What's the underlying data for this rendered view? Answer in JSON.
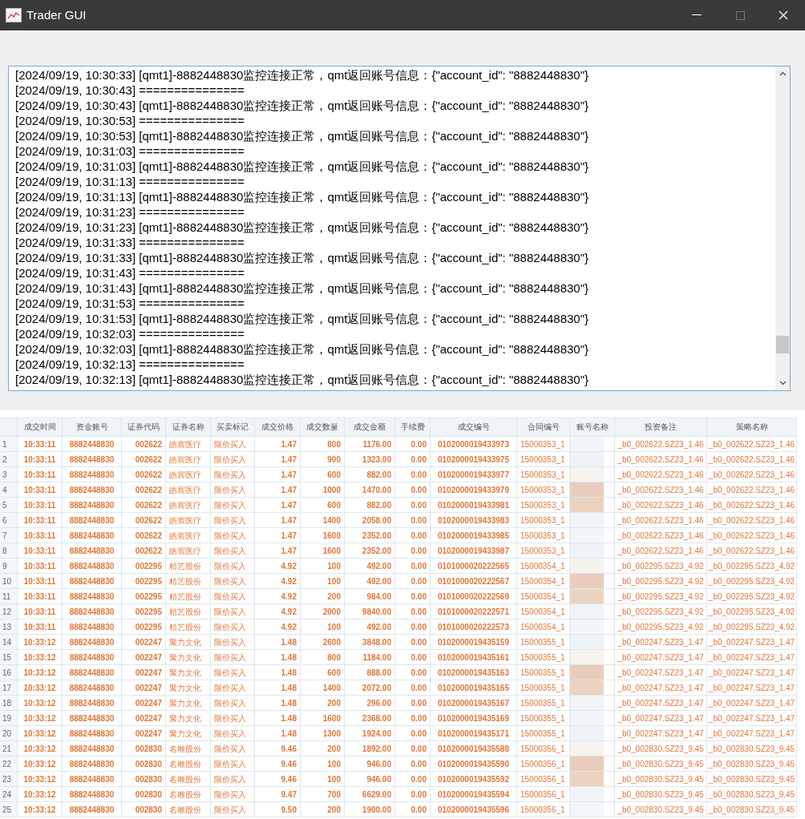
{
  "window": {
    "title": "Trader GUI"
  },
  "log": {
    "lines": [
      "[2024/09/19, 10:30:33] [qmt1]-8882448830监控连接正常，qmt返回账号信息：{\"account_id\": \"8882448830\"}",
      "[2024/09/19, 10:30:43] ===============",
      "[2024/09/19, 10:30:43] [qmt1]-8882448830监控连接正常，qmt返回账号信息：{\"account_id\": \"8882448830\"}",
      "[2024/09/19, 10:30:53] ===============",
      "[2024/09/19, 10:30:53] [qmt1]-8882448830监控连接正常，qmt返回账号信息：{\"account_id\": \"8882448830\"}",
      "[2024/09/19, 10:31:03] ===============",
      "[2024/09/19, 10:31:03] [qmt1]-8882448830监控连接正常，qmt返回账号信息：{\"account_id\": \"8882448830\"}",
      "[2024/09/19, 10:31:13] ===============",
      "[2024/09/19, 10:31:13] [qmt1]-8882448830监控连接正常，qmt返回账号信息：{\"account_id\": \"8882448830\"}",
      "[2024/09/19, 10:31:23] ===============",
      "[2024/09/19, 10:31:23] [qmt1]-8882448830监控连接正常，qmt返回账号信息：{\"account_id\": \"8882448830\"}",
      "[2024/09/19, 10:31:33] ===============",
      "[2024/09/19, 10:31:33] [qmt1]-8882448830监控连接正常，qmt返回账号信息：{\"account_id\": \"8882448830\"}",
      "[2024/09/19, 10:31:43] ===============",
      "[2024/09/19, 10:31:43] [qmt1]-8882448830监控连接正常，qmt返回账号信息：{\"account_id\": \"8882448830\"}",
      "[2024/09/19, 10:31:53] ===============",
      "[2024/09/19, 10:31:53] [qmt1]-8882448830监控连接正常，qmt返回账号信息：{\"account_id\": \"8882448830\"}",
      "[2024/09/19, 10:32:03] ===============",
      "[2024/09/19, 10:32:03] [qmt1]-8882448830监控连接正常，qmt返回账号信息：{\"account_id\": \"8882448830\"}",
      "[2024/09/19, 10:32:13] ===============",
      "[2024/09/19, 10:32:13] [qmt1]-8882448830监控连接正常，qmt返回账号信息：{\"account_id\": \"8882448830\"}"
    ]
  },
  "table": {
    "columns": [
      "成交时间",
      "资金账号",
      "证券代码",
      "证券名称",
      "买卖标记",
      "成交价格",
      "成交数量",
      "成交金额",
      "手续费",
      "成交编号",
      "合同编号",
      "账号名称",
      "投资备注",
      "策略名称"
    ],
    "rows": [
      {
        "n": "1",
        "cells": [
          "10:33:11",
          "8882448830",
          "002622",
          "皓宸医疗",
          "限价买入",
          "1.47",
          "800",
          "1176.00",
          "0.00",
          "0102000019433973",
          "15000353_1",
          "",
          "_b0_002622.SZ23_1.46",
          "_b0_002622.SZ23_1.46"
        ]
      },
      {
        "n": "2",
        "cells": [
          "10:33:11",
          "8882448830",
          "002622",
          "皓宸医疗",
          "限价买入",
          "1.47",
          "900",
          "1323.00",
          "0.00",
          "0102000019433975",
          "15000353_1",
          "",
          "_b0_002622.SZ23_1.46",
          "_b0_002622.SZ23_1.46"
        ]
      },
      {
        "n": "3",
        "cells": [
          "10:33:11",
          "8882448830",
          "002622",
          "皓宸医疗",
          "限价买入",
          "1.47",
          "600",
          "882.00",
          "0.00",
          "0102000019433977",
          "15000353_1",
          "",
          "_b0_002622.SZ23_1.46",
          "_b0_002622.SZ23_1.46"
        ]
      },
      {
        "n": "4",
        "cells": [
          "10:33:11",
          "8882448830",
          "002622",
          "皓宸医疗",
          "限价买入",
          "1.47",
          "1000",
          "1470.00",
          "0.00",
          "0102000019433979",
          "15000353_1",
          "",
          "_b0_002622.SZ23_1.46",
          "_b0_002622.SZ23_1.46"
        ]
      },
      {
        "n": "5",
        "cells": [
          "10:33:11",
          "8882448830",
          "002622",
          "皓宸医疗",
          "限价买入",
          "1.47",
          "600",
          "882.00",
          "0.00",
          "0102000019433981",
          "15000353_1",
          "",
          "_b0_002622.SZ23_1.46",
          "_b0_002622.SZ23_1.46"
        ]
      },
      {
        "n": "6",
        "cells": [
          "10:33:11",
          "8882448830",
          "002622",
          "皓宸医疗",
          "限价买入",
          "1.47",
          "1400",
          "2058.00",
          "0.00",
          "0102000019433983",
          "15000353_1",
          "",
          "_b0_002622.SZ23_1.46",
          "_b0_002622.SZ23_1.46"
        ]
      },
      {
        "n": "7",
        "cells": [
          "10:33:11",
          "8882448830",
          "002622",
          "皓宸医疗",
          "限价买入",
          "1.47",
          "1600",
          "2352.00",
          "0.00",
          "0102000019433985",
          "15000353_1",
          "",
          "_b0_002622.SZ23_1.46",
          "_b0_002622.SZ23_1.46"
        ]
      },
      {
        "n": "8",
        "cells": [
          "10:33:11",
          "8882448830",
          "002622",
          "皓宸医疗",
          "限价买入",
          "1.47",
          "1600",
          "2352.00",
          "0.00",
          "0102000019433987",
          "15000353_1",
          "",
          "_b0_002622.SZ23_1.46",
          "_b0_002622.SZ23_1.46"
        ]
      },
      {
        "n": "9",
        "cells": [
          "10:33:11",
          "8882448830",
          "002295",
          "精艺股份",
          "限价买入",
          "4.92",
          "100",
          "492.00",
          "0.00",
          "0101000020222565",
          "15000354_1",
          "",
          "_b0_002295.SZ23_4.92",
          "_b0_002295.SZ23_4.92"
        ]
      },
      {
        "n": "10",
        "cells": [
          "10:33:11",
          "8882448830",
          "002295",
          "精艺股份",
          "限价买入",
          "4.92",
          "100",
          "492.00",
          "0.00",
          "0101000020222567",
          "15000354_1",
          "",
          "_b0_002295.SZ23_4.92",
          "_b0_002295.SZ23_4.92"
        ]
      },
      {
        "n": "11",
        "cells": [
          "10:33:11",
          "8882448830",
          "002295",
          "精艺股份",
          "限价买入",
          "4.92",
          "200",
          "984.00",
          "0.00",
          "0101000020222569",
          "15000354_1",
          "",
          "_b0_002295.SZ23_4.92",
          "_b0_002295.SZ23_4.92"
        ]
      },
      {
        "n": "12",
        "cells": [
          "10:33:11",
          "8882448830",
          "002295",
          "精艺股份",
          "限价买入",
          "4.92",
          "2000",
          "9840.00",
          "0.00",
          "0101000020222571",
          "15000354_1",
          "",
          "_b0_002295.SZ23_4.92",
          "_b0_002295.SZ23_4.92"
        ]
      },
      {
        "n": "13",
        "cells": [
          "10:33:11",
          "8882448830",
          "002295",
          "精艺股份",
          "限价买入",
          "4.92",
          "100",
          "492.00",
          "0.00",
          "0101000020222573",
          "15000354_1",
          "",
          "_b0_002295.SZ23_4.92",
          "_b0_002295.SZ23_4.92"
        ]
      },
      {
        "n": "14",
        "cells": [
          "10:33:12",
          "8882448830",
          "002247",
          "聚力文化",
          "限价买入",
          "1.48",
          "2600",
          "3848.00",
          "0.00",
          "0102000019435159",
          "15000355_1",
          "",
          "_b0_002247.SZ23_1.47",
          "_b0_002247.SZ23_1.47"
        ]
      },
      {
        "n": "15",
        "cells": [
          "10:33:12",
          "8882448830",
          "002247",
          "聚力文化",
          "限价买入",
          "1.48",
          "800",
          "1184.00",
          "0.00",
          "0102000019435161",
          "15000355_1",
          "",
          "_b0_002247.SZ23_1.47",
          "_b0_002247.SZ23_1.47"
        ]
      },
      {
        "n": "16",
        "cells": [
          "10:33:12",
          "8882448830",
          "002247",
          "聚力文化",
          "限价买入",
          "1.48",
          "600",
          "888.00",
          "0.00",
          "0102000019435163",
          "15000355_1",
          "",
          "_b0_002247.SZ23_1.47",
          "_b0_002247.SZ23_1.47"
        ]
      },
      {
        "n": "17",
        "cells": [
          "10:33:12",
          "8882448830",
          "002247",
          "聚力文化",
          "限价买入",
          "1.48",
          "1400",
          "2072.00",
          "0.00",
          "0102000019435165",
          "15000355_1",
          "",
          "_b0_002247.SZ23_1.47",
          "_b0_002247.SZ23_1.47"
        ]
      },
      {
        "n": "18",
        "cells": [
          "10:33:12",
          "8882448830",
          "002247",
          "聚力文化",
          "限价买入",
          "1.48",
          "200",
          "296.00",
          "0.00",
          "0102000019435167",
          "15000355_1",
          "",
          "_b0_002247.SZ23_1.47",
          "_b0_002247.SZ23_1.47"
        ]
      },
      {
        "n": "19",
        "cells": [
          "10:33:12",
          "8882448830",
          "002247",
          "聚力文化",
          "限价买入",
          "1.48",
          "1600",
          "2368.00",
          "0.00",
          "0102000019435169",
          "15000355_1",
          "",
          "_b0_002247.SZ23_1.47",
          "_b0_002247.SZ23_1.47"
        ]
      },
      {
        "n": "20",
        "cells": [
          "10:33:12",
          "8882448830",
          "002247",
          "聚力文化",
          "限价买入",
          "1.48",
          "1300",
          "1924.00",
          "0.00",
          "0102000019435171",
          "15000355_1",
          "",
          "_b0_002247.SZ23_1.47",
          "_b0_002247.SZ23_1.47"
        ]
      },
      {
        "n": "21",
        "cells": [
          "10:33:12",
          "8882448830",
          "002830",
          "名雕股份",
          "限价买入",
          "9.46",
          "200",
          "1892.00",
          "0.00",
          "0102000019435588",
          "15000356_1",
          "",
          "_b0_002830.SZ23_9.45",
          "_b0_002830.SZ23_9.45"
        ]
      },
      {
        "n": "22",
        "cells": [
          "10:33:12",
          "8882448830",
          "002830",
          "名雕股份",
          "限价买入",
          "9.46",
          "100",
          "946.00",
          "0.00",
          "0102000019435590",
          "15000356_1",
          "",
          "_b0_002830.SZ23_9.45",
          "_b0_002830.SZ23_9.45"
        ]
      },
      {
        "n": "23",
        "cells": [
          "10:33:12",
          "8882448830",
          "002830",
          "名雕股份",
          "限价买入",
          "9.46",
          "100",
          "946.00",
          "0.00",
          "0102000019435592",
          "15000356_1",
          "",
          "_b0_002830.SZ23_9.45",
          "_b0_002830.SZ23_9.45"
        ]
      },
      {
        "n": "24",
        "cells": [
          "10:33:12",
          "8882448830",
          "002830",
          "名雕股份",
          "限价买入",
          "9.47",
          "700",
          "6629.00",
          "0.00",
          "0102000019435594",
          "15000356_1",
          "",
          "_b0_002830.SZ23_9.45",
          "_b0_002830.SZ23_9.45"
        ]
      },
      {
        "n": "25",
        "cells": [
          "10:33:12",
          "8882448830",
          "002830",
          "名雕股份",
          "限价买入",
          "9.50",
          "200",
          "1900.00",
          "0.00",
          "0102000019435596",
          "15000356_1",
          "",
          "_b0_002830.SZ23_9.45",
          "_b0_002830.SZ23_9.45"
        ]
      }
    ]
  }
}
